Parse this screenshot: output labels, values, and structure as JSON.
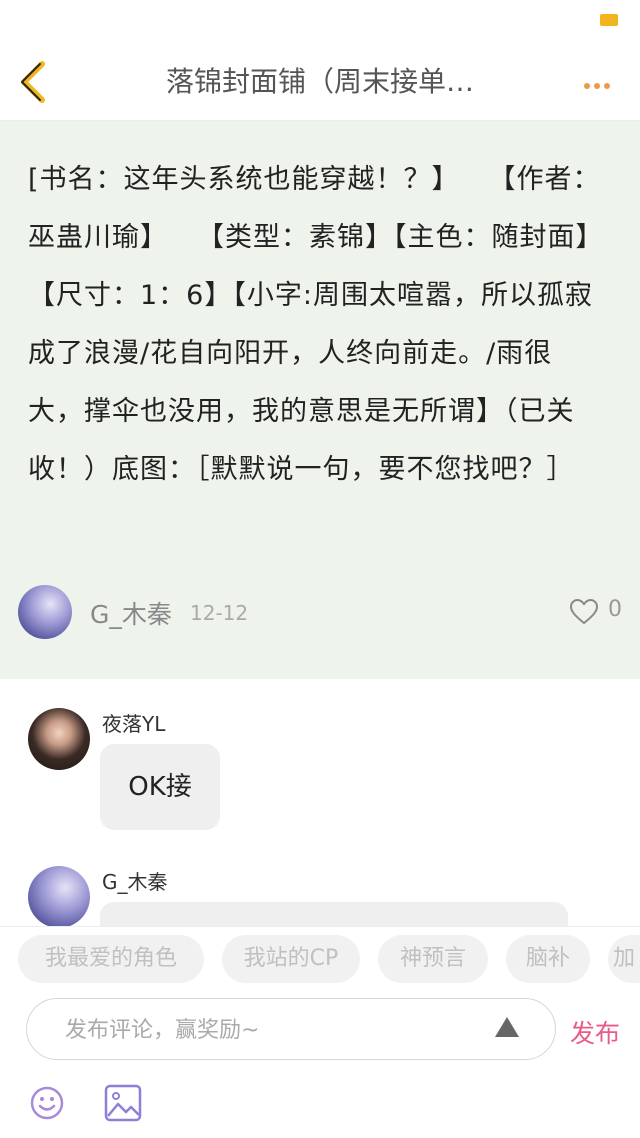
{
  "nav": {
    "title": "落锦封面铺（周末接单…",
    "back_icon": "chevron-left-icon",
    "more_icon": "more-dots-icon"
  },
  "post": {
    "body": "[书名：这年头系统也能穿越！？】　　【作者：巫蛊川瑜】　　【类型：素锦】【主色：随封面】【尺寸：1：6】【小字:周围太喧嚣，所以孤寂成了浪漫/花自向阳开，人终向前走。/雨很大，撑伞也没用，我的意思是无所谓】（已关收！）底图：［默默说一句，要不您找吧？］",
    "author": "G_木秦",
    "date": "12-12",
    "like_count": "0"
  },
  "comments": [
    {
      "name": "夜落YL",
      "text": "OK接"
    },
    {
      "name": "G_木秦",
      "text": ""
    }
  ],
  "tags": [
    "我最爱的角色",
    "我站的CP",
    "神预言",
    "脑补",
    "加"
  ],
  "input": {
    "placeholder": "发布评论，赢奖励~",
    "publish_label": "发布"
  },
  "colors": {
    "accent": "#f2b51d",
    "post_background": "#eef3ec",
    "publish": "#ea5a86",
    "more_dots": "#ee9a4a",
    "emoji_icon": "#a78ad8",
    "image_icon": "#8f7fd8"
  }
}
